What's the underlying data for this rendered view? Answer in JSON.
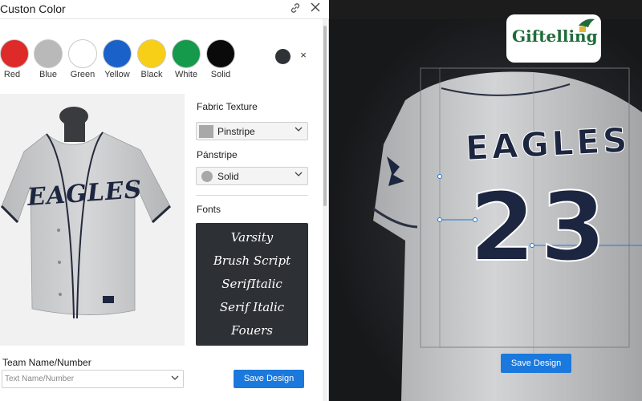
{
  "window": {
    "title": "Custon Color"
  },
  "toolbar": {
    "link_icon": "link-icon",
    "close_icon": "close-icon"
  },
  "swatches": [
    {
      "label": "Red",
      "color": "#df2a2a"
    },
    {
      "label": "Blue",
      "color": "#b9b9b9"
    },
    {
      "label": "Green",
      "color": "#ffffff"
    },
    {
      "label": "Yellow",
      "color": "#1a62c9"
    },
    {
      "label": "Black",
      "color": "#f7cf16"
    },
    {
      "label": "White",
      "color": "#15994a"
    },
    {
      "label": "Solid",
      "color": "#0a0a0a"
    }
  ],
  "selected_color": {
    "color": "#2f3237",
    "remove_label": "×"
  },
  "fabric": {
    "heading": "Fabric Texture",
    "selected": "Pinstripe",
    "pattern_heading": "Pánstripe",
    "pattern_selected": "Solid"
  },
  "fonts": {
    "heading": "Fonts",
    "items": [
      "Varsity",
      "Brush Script",
      "SerifItalic",
      "Serif Italic",
      "Fouers"
    ]
  },
  "team": {
    "label": "Team Name/Number",
    "placeholder": "Text Name/Number"
  },
  "actions": {
    "save_label": "Save Design",
    "stage_save_label": "Save Design"
  },
  "jersey": {
    "team_text": "EAGLES",
    "number": "23"
  },
  "brand": {
    "logo_text": "Giftelling"
  },
  "colors": {
    "accent": "#1b79dd",
    "navy": "#1d2640",
    "jersey": "#c9cacc"
  }
}
